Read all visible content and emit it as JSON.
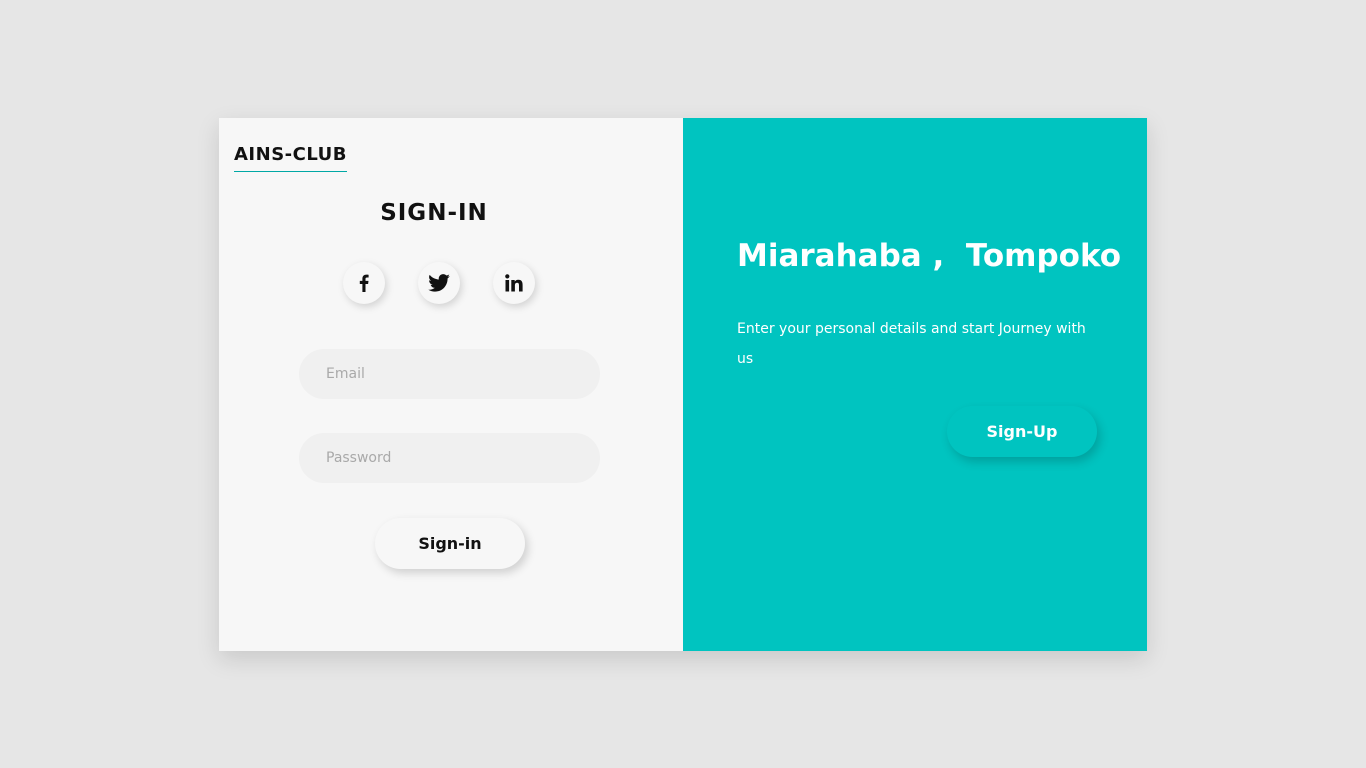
{
  "brand": {
    "name": "AINS-CLUB"
  },
  "signin": {
    "title": "SIGN-IN",
    "social": [
      {
        "name": "facebook",
        "icon": "facebook-icon"
      },
      {
        "name": "twitter",
        "icon": "twitter-icon"
      },
      {
        "name": "linkedin",
        "icon": "linkedin-icon"
      }
    ],
    "email_placeholder": "Email",
    "email_value": "",
    "password_placeholder": "Password",
    "password_value": "",
    "button_label": "Sign-in"
  },
  "signup": {
    "greeting": "Miarahaba ,  Tompoko",
    "description": "Enter your personal details and  start Journey with us",
    "button_label": "Sign-Up"
  },
  "colors": {
    "background": "#e6e6e6",
    "panel_left": "#f7f7f7",
    "accent": "#00c4c0",
    "input_bg": "#f0f0f0"
  }
}
